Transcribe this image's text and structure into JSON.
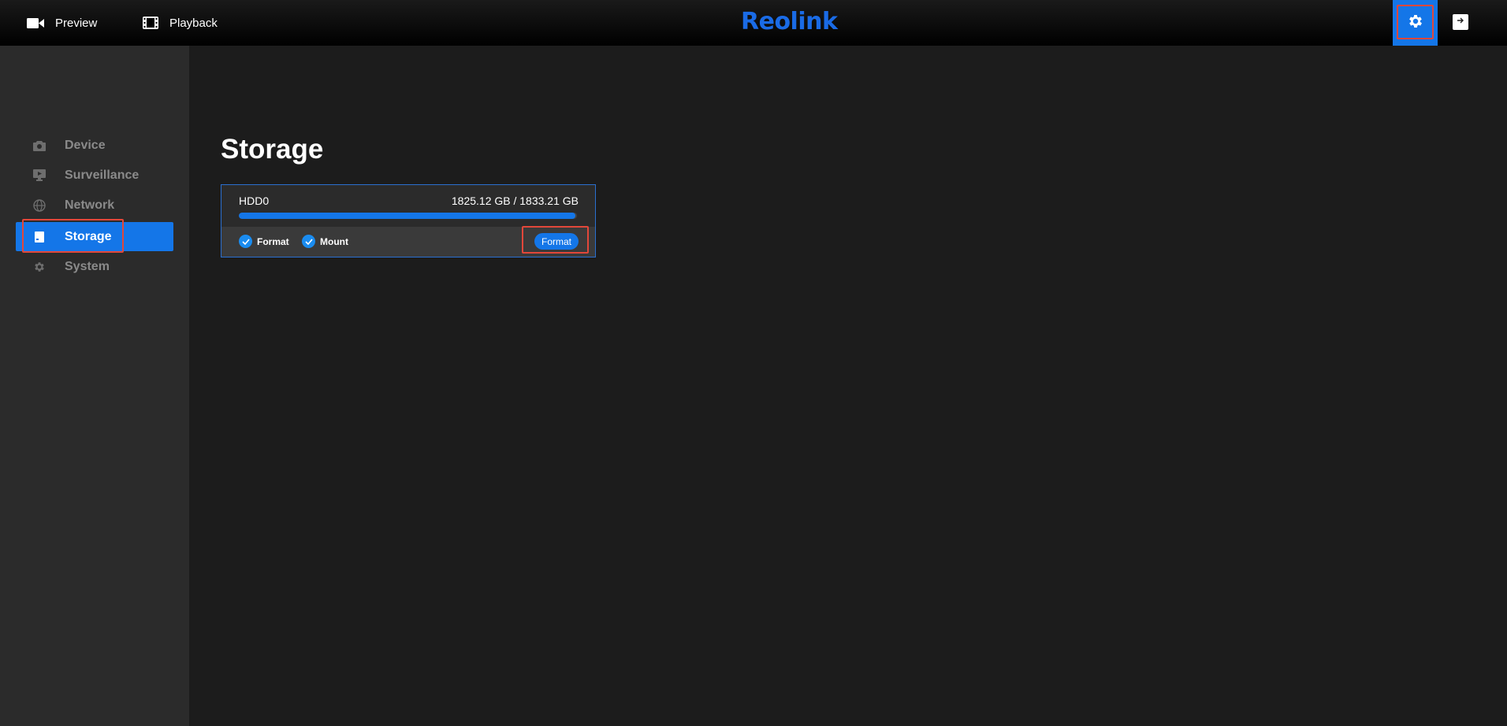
{
  "header": {
    "preview_label": "Preview",
    "playback_label": "Playback",
    "logo_text": "Reolink",
    "icons": {
      "preview": "video-camera-icon",
      "playback": "film-icon",
      "settings": "gear-icon",
      "logout": "logout-icon"
    }
  },
  "sidebar": {
    "items": [
      {
        "label": "Device",
        "icon": "camera-icon",
        "active": false
      },
      {
        "label": "Surveillance",
        "icon": "monitor-icon",
        "active": false
      },
      {
        "label": "Network",
        "icon": "globe-icon",
        "active": false
      },
      {
        "label": "Storage",
        "icon": "storage-icon",
        "active": true
      },
      {
        "label": "System",
        "icon": "gear-icon",
        "active": false
      }
    ]
  },
  "main": {
    "title": "Storage",
    "disks": [
      {
        "name": "HDD0",
        "capacity": "1825.12 GB / 1833.21 GB",
        "used_fraction": 0.9956,
        "format_checkbox_label": "Format",
        "mount_checkbox_label": "Mount",
        "format_button_label": "Format"
      }
    ]
  },
  "colors": {
    "accent": "#1476e8",
    "logo": "#1a6be6",
    "highlight": "#e2473a",
    "sidebar_bg": "#2b2b2b",
    "main_bg": "#1c1c1c"
  }
}
